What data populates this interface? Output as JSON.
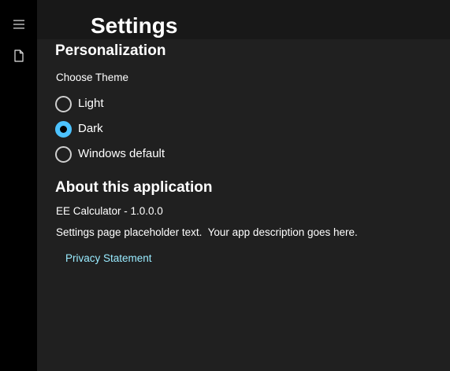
{
  "nav": {
    "menu_icon": "hamburger-menu-icon",
    "page_icon": "document-icon"
  },
  "header": {
    "title": "Settings"
  },
  "personalization": {
    "heading": "Personalization",
    "theme_label": "Choose Theme",
    "options": [
      {
        "label": "Light",
        "selected": false
      },
      {
        "label": "Dark",
        "selected": true
      },
      {
        "label": "Windows default",
        "selected": false
      }
    ]
  },
  "about": {
    "heading": "About this application",
    "version": "EE Calculator - 1.0.0.0",
    "description": "Settings page placeholder text.  Your app description goes here.",
    "privacy_link": "Privacy Statement"
  },
  "colors": {
    "accent": "#4cc2ff",
    "link": "#99ebff",
    "background": "#202020",
    "nav_background": "#000000"
  }
}
